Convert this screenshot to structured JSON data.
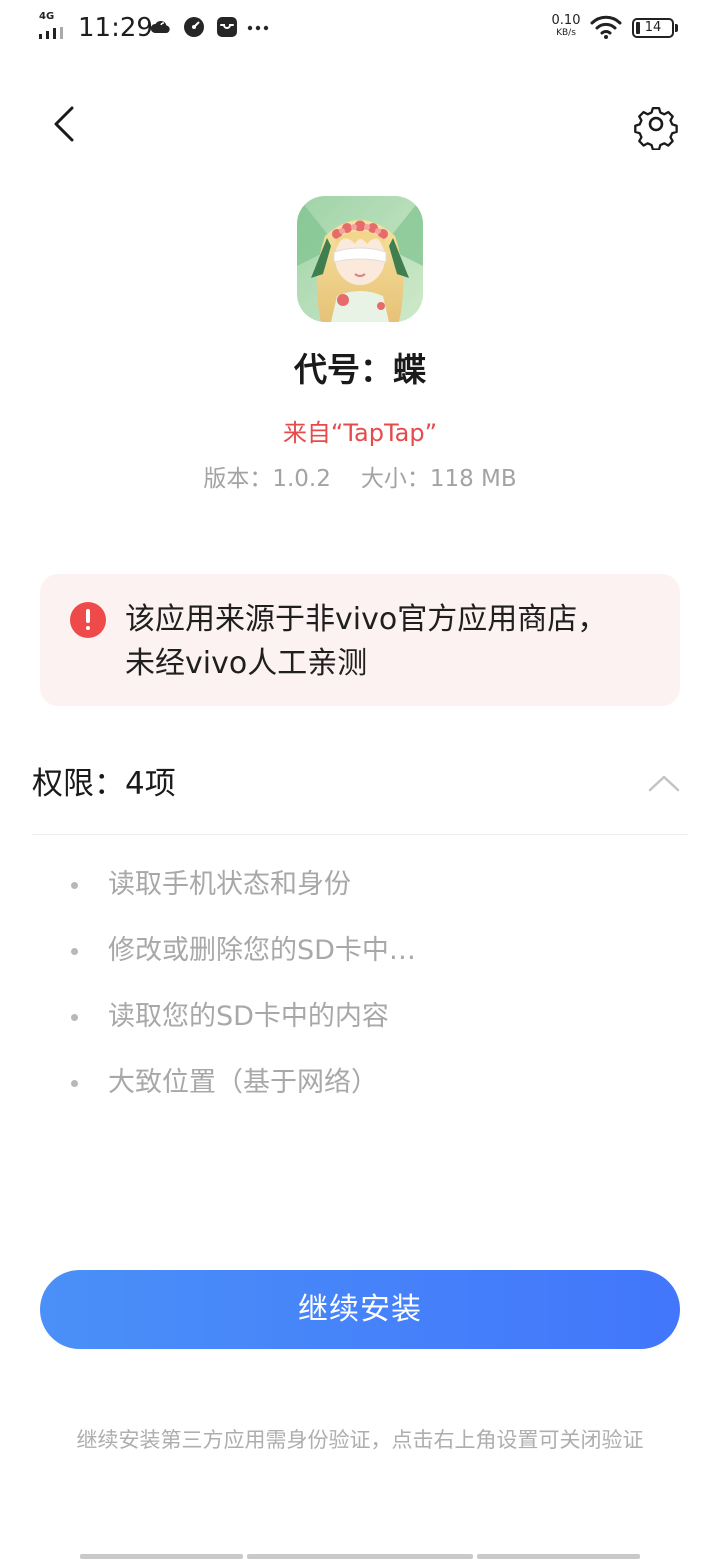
{
  "status_bar": {
    "network": "4G",
    "time": "11:29",
    "speed_value": "0.10",
    "speed_unit": "KB/s",
    "battery": "14",
    "icons": [
      "cloud-icon",
      "speedometer-icon",
      "inbox-icon",
      "more-dots-icon"
    ]
  },
  "header": {
    "back_icon": "chevron-left-icon",
    "settings_icon": "gear-icon"
  },
  "app": {
    "name": "代号：蝶",
    "source": "来自“TapTap”",
    "version": "版本：1.0.2",
    "size": "大小：118 MB"
  },
  "warning": {
    "icon": "exclamation-circle-icon",
    "text": "该应用来源于非vivo官方应用商店，未经vivo人工亲测"
  },
  "permissions": {
    "title": "权限：4项",
    "expanded": true,
    "items": [
      "读取手机状态和身份",
      "修改或删除您的SD卡中…",
      "读取您的SD卡中的内容",
      "大致位置（基于网络）"
    ]
  },
  "continue_button": "继续安装",
  "footer_note": "继续安装第三方应用需身份验证，点击右上角设置可关闭验证",
  "colors": {
    "accent": "#4a90f8",
    "warning_red": "#ef4a4a",
    "source_red": "#e54b4b",
    "warning_bg": "#fdf2f2"
  }
}
